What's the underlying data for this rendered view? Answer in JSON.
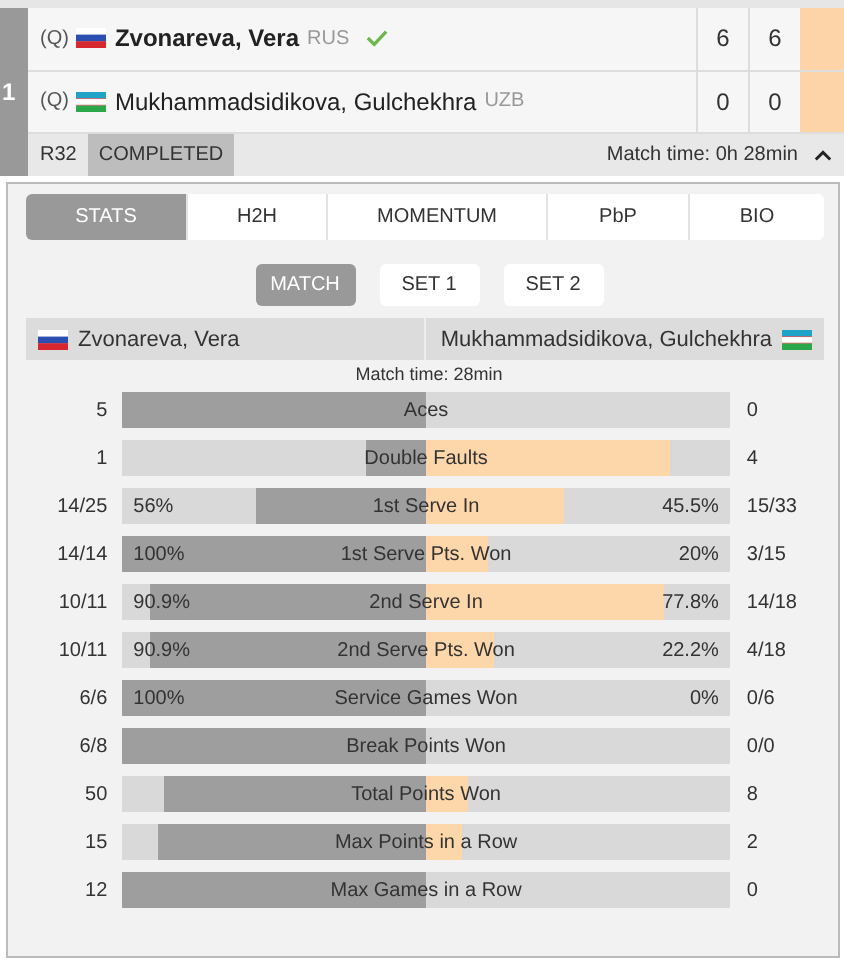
{
  "match": {
    "number": "1",
    "players": [
      {
        "seed": "(Q)",
        "flag": {
          "kind": "rus"
        },
        "name": "Zvonareva, Vera",
        "country": "RUS",
        "winner": true,
        "sets": [
          "6",
          "6"
        ]
      },
      {
        "seed": "(Q)",
        "flag": {
          "kind": "uzb"
        },
        "name": "Mukhammadsidikova, Gulchekhra",
        "country": "UZB",
        "winner": false,
        "sets": [
          "0",
          "0"
        ]
      }
    ],
    "round": "R32",
    "status": "COMPLETED",
    "match_time": "Match time: 0h 28min",
    "expanded": true
  },
  "tabs": [
    {
      "label": "STATS",
      "selected": true
    },
    {
      "label": "H2H",
      "selected": false
    },
    {
      "label": "MOMENTUM",
      "selected": false
    },
    {
      "label": "PbP",
      "selected": false
    },
    {
      "label": "BIO",
      "selected": false
    }
  ],
  "periods": [
    {
      "label": "MATCH",
      "selected": true
    },
    {
      "label": "SET 1",
      "selected": false
    },
    {
      "label": "SET 2",
      "selected": false
    }
  ],
  "header": {
    "left": {
      "flag": {
        "kind": "rus"
      },
      "name": "Zvonareva, Vera"
    },
    "right": {
      "flag": {
        "kind": "uzb"
      },
      "name": "Mukhammadsidikova, Gulchekhra"
    }
  },
  "stats_time": "Match time: 28min",
  "stats": [
    {
      "label": "Aces",
      "left": {
        "value": "5",
        "level": 1
      },
      "right": {
        "value": "0"
      }
    },
    {
      "label": "Double Faults",
      "left": {
        "value": "1",
        "level": 0.2
      },
      "right": {
        "value": "4",
        "level": 0.8
      }
    },
    {
      "label": "1st Serve In",
      "left": {
        "value": "14/25",
        "pct": "56%",
        "level": 0.56
      },
      "right": {
        "value": "15/33",
        "pct": "45.5%",
        "level": 0.455
      }
    },
    {
      "label": "1st Serve Pts. Won",
      "left": {
        "value": "14/14",
        "pct": "100%",
        "level": 1
      },
      "right": {
        "value": "3/15",
        "pct": "20%",
        "level": 0.2
      }
    },
    {
      "label": "2nd Serve In",
      "left": {
        "value": "10/11",
        "pct": "90.9%",
        "level": 0.909
      },
      "right": {
        "value": "14/18",
        "pct": "77.8%",
        "level": 0.778
      }
    },
    {
      "label": "2nd Serve Pts. Won",
      "left": {
        "value": "10/11",
        "pct": "90.9%",
        "level": 0.909
      },
      "right": {
        "value": "4/18",
        "pct": "22.2%",
        "level": 0.222
      }
    },
    {
      "label": "Service Games Won",
      "left": {
        "value": "6/6",
        "pct": "100%",
        "level": 1
      },
      "right": {
        "value": "0/6",
        "pct": "0%"
      }
    },
    {
      "label": "Break Points Won",
      "left": {
        "value": "6/8",
        "level": 1
      },
      "right": {
        "value": "0/0"
      }
    },
    {
      "label": "Total Points Won",
      "left": {
        "value": "50",
        "level": 0.86
      },
      "right": {
        "value": "8",
        "level": 0.14
      }
    },
    {
      "label": "Max Points in a Row",
      "left": {
        "value": "15",
        "level": 0.88
      },
      "right": {
        "value": "2",
        "level": 0.12
      }
    },
    {
      "label": "Max Games in a Row",
      "left": {
        "value": "12",
        "level": 1
      },
      "right": {
        "value": "0"
      }
    }
  ]
}
